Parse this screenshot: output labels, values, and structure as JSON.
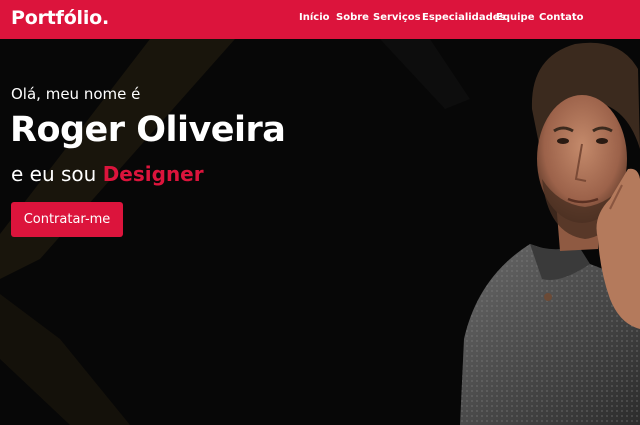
{
  "brand": {
    "logo": "Portfólio.",
    "accent": "#dc143c"
  },
  "nav": {
    "items": [
      {
        "label": "Início"
      },
      {
        "label": "Sobre"
      },
      {
        "label": "Serviços"
      },
      {
        "label": "Especialidades"
      },
      {
        "label": "Equipe"
      },
      {
        "label": "Contato"
      }
    ]
  },
  "hero": {
    "greeting": "Olá, meu nome é",
    "name": "Roger Oliveira",
    "role_prefix": "e eu sou",
    "role": "Designer",
    "cta_label": "Contratar-me",
    "portrait_icon": "man-portrait"
  }
}
